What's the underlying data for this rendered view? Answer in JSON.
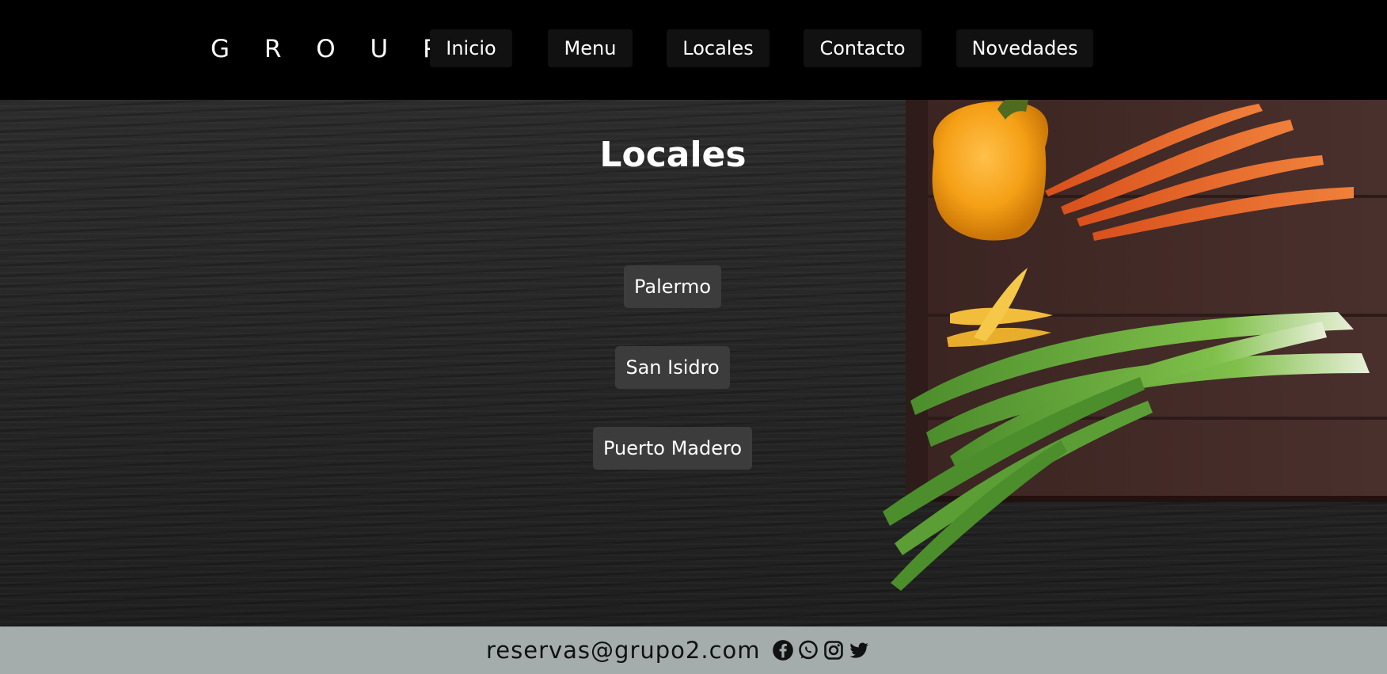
{
  "header": {
    "brand": "G R O U P 2",
    "nav": [
      {
        "label": "Inicio"
      },
      {
        "label": "Menu"
      },
      {
        "label": "Locales"
      },
      {
        "label": "Contacto"
      },
      {
        "label": "Novedades"
      }
    ]
  },
  "main": {
    "title": "Locales",
    "locations": [
      {
        "label": "Palermo"
      },
      {
        "label": "San Isidro"
      },
      {
        "label": "Puerto Madero"
      }
    ],
    "image_semantic": "vegetables-on-wooden-board"
  },
  "footer": {
    "email": "reservas@grupo2.com",
    "social_icons": [
      "facebook-icon",
      "whatsapp-icon",
      "instagram-icon",
      "twitter-icon"
    ]
  },
  "colors": {
    "header_bg": "#000000",
    "nav_button_bg": "#111111",
    "location_button_bg": "#3c3c3c",
    "footer_bg": "#a5acac"
  }
}
